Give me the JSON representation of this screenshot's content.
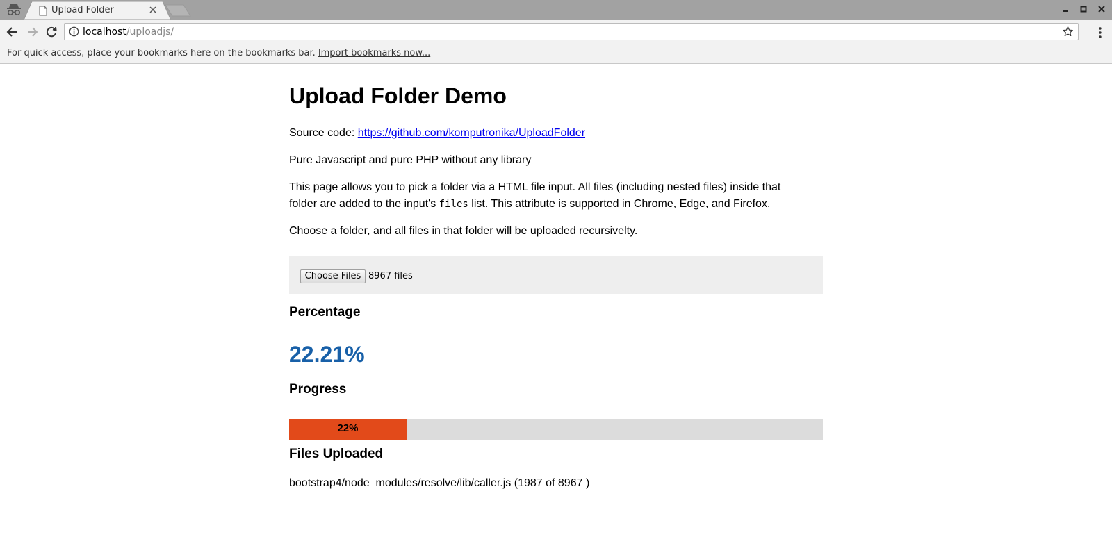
{
  "browser": {
    "tab_title": "Upload Folder",
    "url_host": "localhost",
    "url_path": "/uploadjs/",
    "bookmarks_text": "For quick access, place your bookmarks here on the bookmarks bar.",
    "bookmarks_link": "Import bookmarks now..."
  },
  "page": {
    "title": "Upload Folder Demo",
    "source_label": "Source code: ",
    "source_link": "https://github.com/komputronika/UploadFolder",
    "tagline": "Pure Javascript and pure PHP without any library",
    "desc_line1": "This page allows you to pick a folder via a HTML file input. All files (including nested files) inside that",
    "desc_line2_a": "folder are added to the input's ",
    "desc_code": "files",
    "desc_line2_b": " list. This attribute is supported in Chrome, Edge, and Firefox.",
    "instruction": "Choose a folder, and all files in that folder will be uploaded recursivelty.",
    "choose_button": "Choose Files",
    "file_count": "8967 files",
    "percentage_heading": "Percentage",
    "percentage_value": "22.21%",
    "progress_heading": "Progress",
    "progress_fraction": 0.22,
    "progress_label": "22%",
    "files_heading": "Files Uploaded",
    "current_file": "bootstrap4/node_modules/resolve/lib/caller.js (1987 of 8967 )"
  },
  "colors": {
    "progress_fill": "#e24a1a",
    "progress_track": "#dcdcdc",
    "percentage_text": "#1860a8",
    "link": "#0000ee"
  }
}
